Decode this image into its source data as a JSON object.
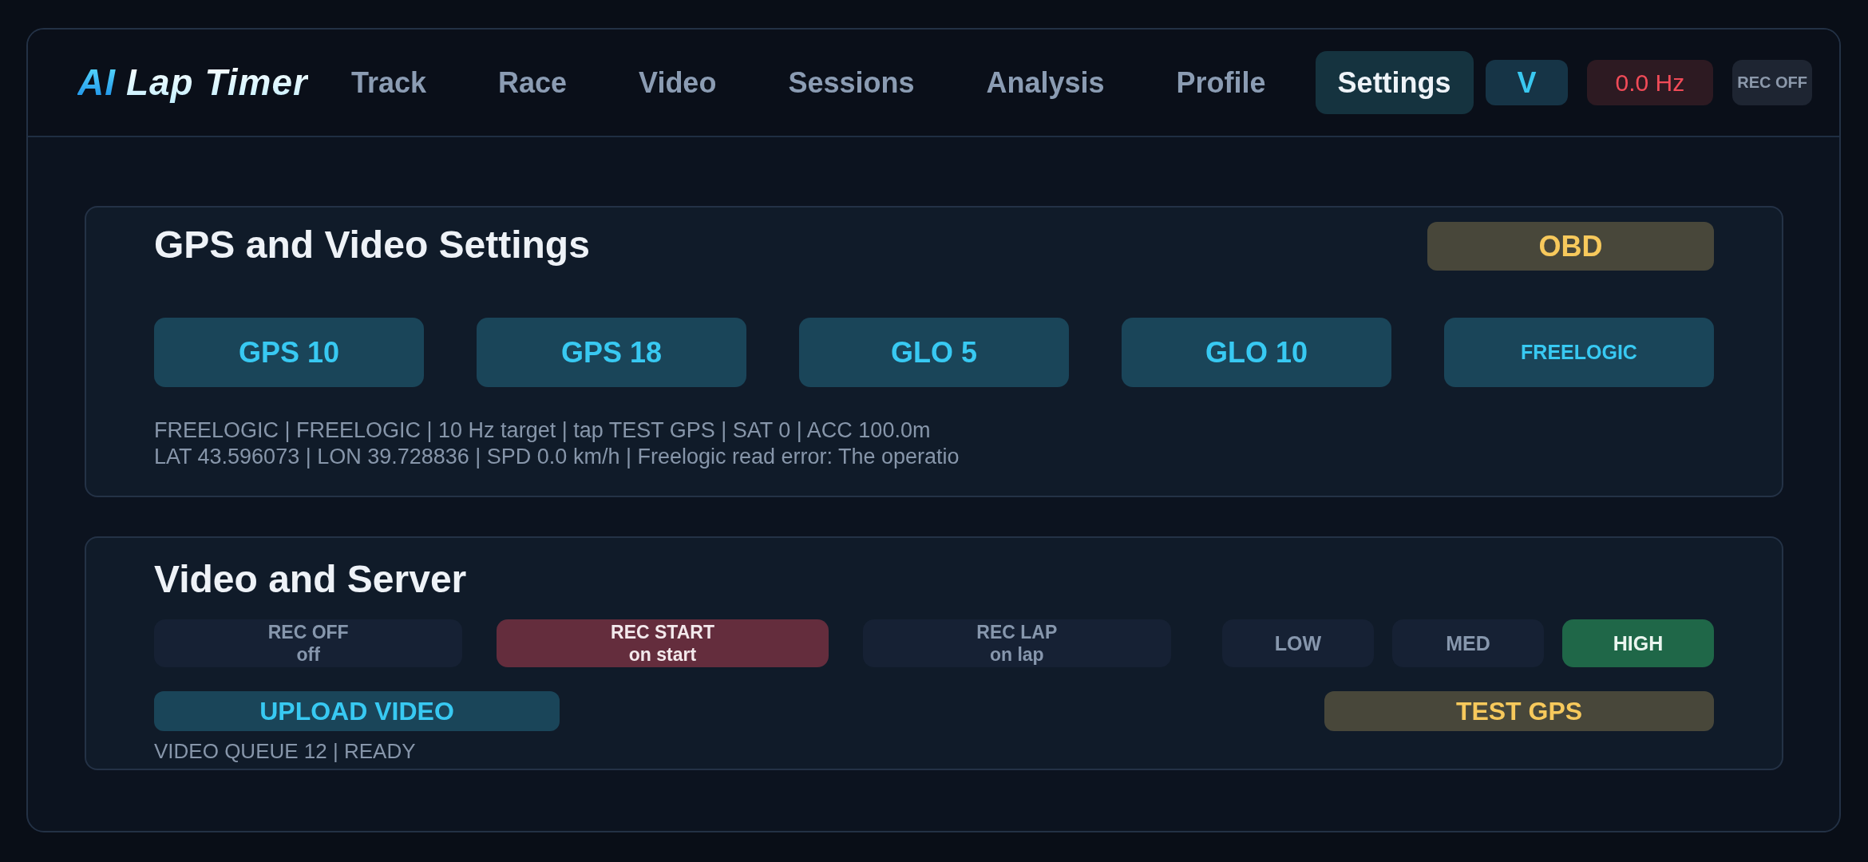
{
  "header": {
    "logo": {
      "accent": "AI",
      "name": "Lap Timer"
    },
    "tabs": [
      {
        "label": "Track",
        "selected": false
      },
      {
        "label": "Race",
        "selected": false
      },
      {
        "label": "Video",
        "selected": false
      },
      {
        "label": "Sessions",
        "selected": false
      },
      {
        "label": "Analysis",
        "selected": false
      },
      {
        "label": "Profile",
        "selected": false
      },
      {
        "label": "Settings",
        "selected": true
      }
    ],
    "badges": [
      {
        "label": "V",
        "kind": "accent"
      },
      {
        "label": "0.0 Hz",
        "kind": "alert"
      },
      {
        "label": "REC OFF",
        "kind": "muted"
      }
    ]
  },
  "gps_card": {
    "title": "GPS and Video Settings",
    "obd_button": "OBD",
    "presets": [
      {
        "label": "GPS 10",
        "kind": "rate"
      },
      {
        "label": "GPS 18",
        "kind": "rate"
      },
      {
        "label": "GLO 5",
        "kind": "rate"
      },
      {
        "label": "GLO 10",
        "kind": "rate"
      },
      {
        "label": "FREELOGIC",
        "kind": "source"
      }
    ],
    "status_lines": [
      "FREELOGIC | FREELOGIC | 10 Hz target | tap TEST GPS | SAT 0 | ACC 100.0m",
      "LAT 43.596073 | LON 39.728836 | SPD 0.0 km/h | Freelogic read error: The operatio"
    ]
  },
  "video_card": {
    "title": "Video and Server",
    "record_modes": [
      {
        "label": "REC OFF",
        "caption": "off",
        "selected": false
      },
      {
        "label": "REC START",
        "caption": "on start",
        "selected": true
      },
      {
        "label": "REC LAP",
        "caption": "on lap",
        "selected": false
      }
    ],
    "quality": [
      {
        "label": "LOW",
        "selected": false
      },
      {
        "label": "MED",
        "selected": false
      },
      {
        "label": "HIGH",
        "selected": true
      }
    ],
    "upload_button": "UPLOAD VIDEO",
    "test_button": "TEST GPS",
    "queue_status": "VIDEO QUEUE 12 | READY"
  }
}
